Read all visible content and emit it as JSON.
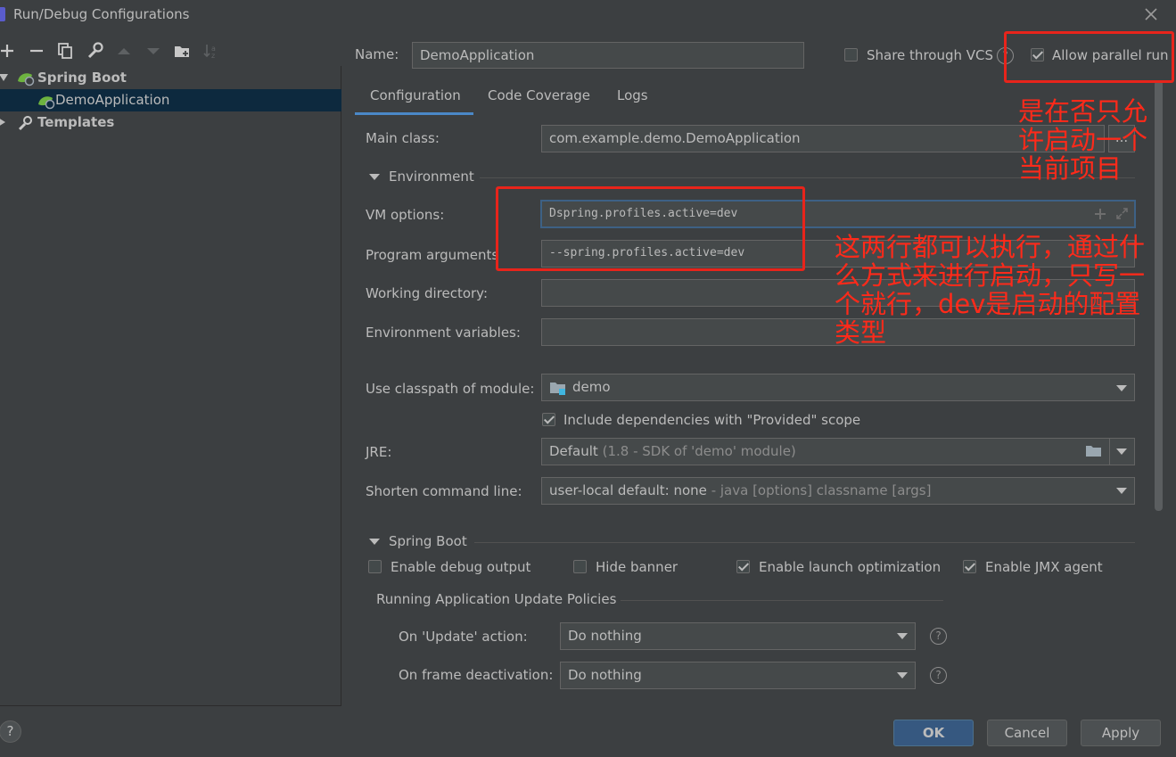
{
  "window": {
    "title": "Run/Debug Configurations"
  },
  "toolbar": {
    "icons": [
      "add-icon",
      "remove-icon",
      "copy-icon",
      "wrench-icon",
      "move-up-icon",
      "move-down-icon",
      "new-folder-icon",
      "sort-icon"
    ]
  },
  "tree": {
    "spring_boot": "Spring Boot",
    "demo_app": "DemoApplication",
    "templates": "Templates"
  },
  "name": {
    "label": "Name:",
    "value": "DemoApplication"
  },
  "share_vcs": {
    "label": "Share through VCS",
    "checked": false
  },
  "allow_parallel": {
    "label": "Allow parallel run",
    "checked": true
  },
  "tabs": [
    "Configuration",
    "Code Coverage",
    "Logs"
  ],
  "main_class": {
    "label": "Main class:",
    "value": "com.example.demo.DemoApplication",
    "browse": "..."
  },
  "environment": {
    "title": "Environment",
    "vm_options_label": "VM options:",
    "vm_options_value": "Dspring.profiles.active=dev",
    "program_args_label": "Program arguments",
    "program_args_value": "--spring.profiles.active=dev",
    "working_dir_label": "Working directory:",
    "env_vars_label": "Environment variables:"
  },
  "classpath": {
    "label": "Use classpath of module:",
    "value": "demo"
  },
  "include_deps": {
    "label": "Include dependencies with \"Provided\" scope",
    "checked": true
  },
  "jre": {
    "label": "JRE:",
    "value": "Default",
    "hint": "(1.8 - SDK of 'demo' module)"
  },
  "shorten": {
    "label": "Shorten command line:",
    "value": "user-local default: none",
    "hint": "- java [options] classname [args]"
  },
  "spring_boot": {
    "title": "Spring Boot",
    "debug_output": {
      "label": "Enable debug output",
      "checked": false
    },
    "hide_banner": {
      "label": "Hide banner",
      "checked": false
    },
    "launch_opt": {
      "label": "Enable launch optimization",
      "checked": true
    },
    "jmx": {
      "label": "Enable JMX agent",
      "checked": true
    },
    "policies_title": "Running Application Update Policies",
    "update_action_label": "On 'Update' action:",
    "update_action_value": "Do nothing",
    "frame_deact_label": "On frame deactivation:",
    "frame_deact_value": "Do nothing"
  },
  "buttons": {
    "help": "?",
    "ok": "OK",
    "cancel": "Cancel",
    "apply": "Apply"
  },
  "annotations": {
    "parallel_note": "是在否只允许启动一个当前项目",
    "options_note": "这两行都可以执行，通过什么方式来进行启动，只写一个就行，dev是启动的配置类型",
    "color": "#e8241b"
  }
}
